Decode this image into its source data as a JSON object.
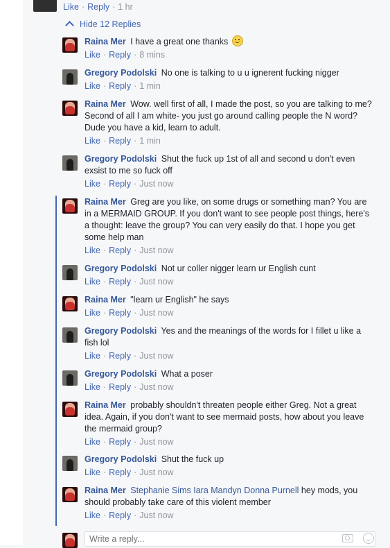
{
  "top_comment": {
    "like": "Like",
    "reply": "Reply",
    "time": "1 hr"
  },
  "hide_replies": "Hide 12 Replies",
  "actions": {
    "like": "Like",
    "reply": "Reply",
    "separator": "·"
  },
  "replies": [
    {
      "author": "Raina Mer",
      "text": "I have a great one thanks",
      "time": "8 mins"
    },
    {
      "author": "Gregory Podolski",
      "text": "No one is talking to u u ignerent fucking nigger",
      "time": "1 min"
    },
    {
      "author": "Raina Mer",
      "text": "Wow. well first of all, I made the post, so you are talking to me? Second of all I am white- you just go around calling people the N word? Dude you have a kid, learn to adult.",
      "time": "1 min"
    },
    {
      "author": "Gregory Podolski",
      "text": "Shut the fuck up 1st of all and second u don't even exsist to me so fuck off",
      "time": "Just now"
    },
    {
      "author": "Raina Mer",
      "text": "Greg are you like, on some drugs or something man? You are in a MERMAID GROUP. If you don't want to see people post things, here's a thought: leave the group? You can very easily do that. I hope you get some help man",
      "time": "Just now"
    },
    {
      "author": "Gregory Podolski",
      "text": "Not ur coller nigger learn ur English cunt",
      "time": "Just now"
    },
    {
      "author": "Raina Mer",
      "text": "\"learn ur English\" he says",
      "time": "Just now"
    },
    {
      "author": "Gregory Podolski",
      "text": "Yes and the meanings of the words for I fillet u like a fish lol",
      "time": "Just now"
    },
    {
      "author": "Gregory Podolski",
      "text": "What a poser",
      "time": "Just now"
    },
    {
      "author": "Raina Mer",
      "text": "probably shouldn't threaten people either Greg. Not a great idea. Again, if you don't want to see mermaid posts, how about you leave the mermaid group?",
      "time": "Just now"
    },
    {
      "author": "Gregory Podolski",
      "text": "Shut the fuck up",
      "time": "Just now"
    },
    {
      "author": "Raina Mer",
      "mentions": "Stephanie Sims Iara Mandyn Donna Purnell",
      "text": "hey mods, you should probably take care of this violent member",
      "time": "Just now"
    }
  ],
  "composer": {
    "placeholder": "Write a reply..."
  },
  "icons": {
    "camera": "camera-icon",
    "emoji": "emoji-icon",
    "chevron": "chevron-up-icon",
    "smiley": "smiley-emoji"
  },
  "colors": {
    "link": "#4267b2",
    "author": "#365899",
    "meta": "#90949c",
    "thread_line": "#4267b2"
  }
}
